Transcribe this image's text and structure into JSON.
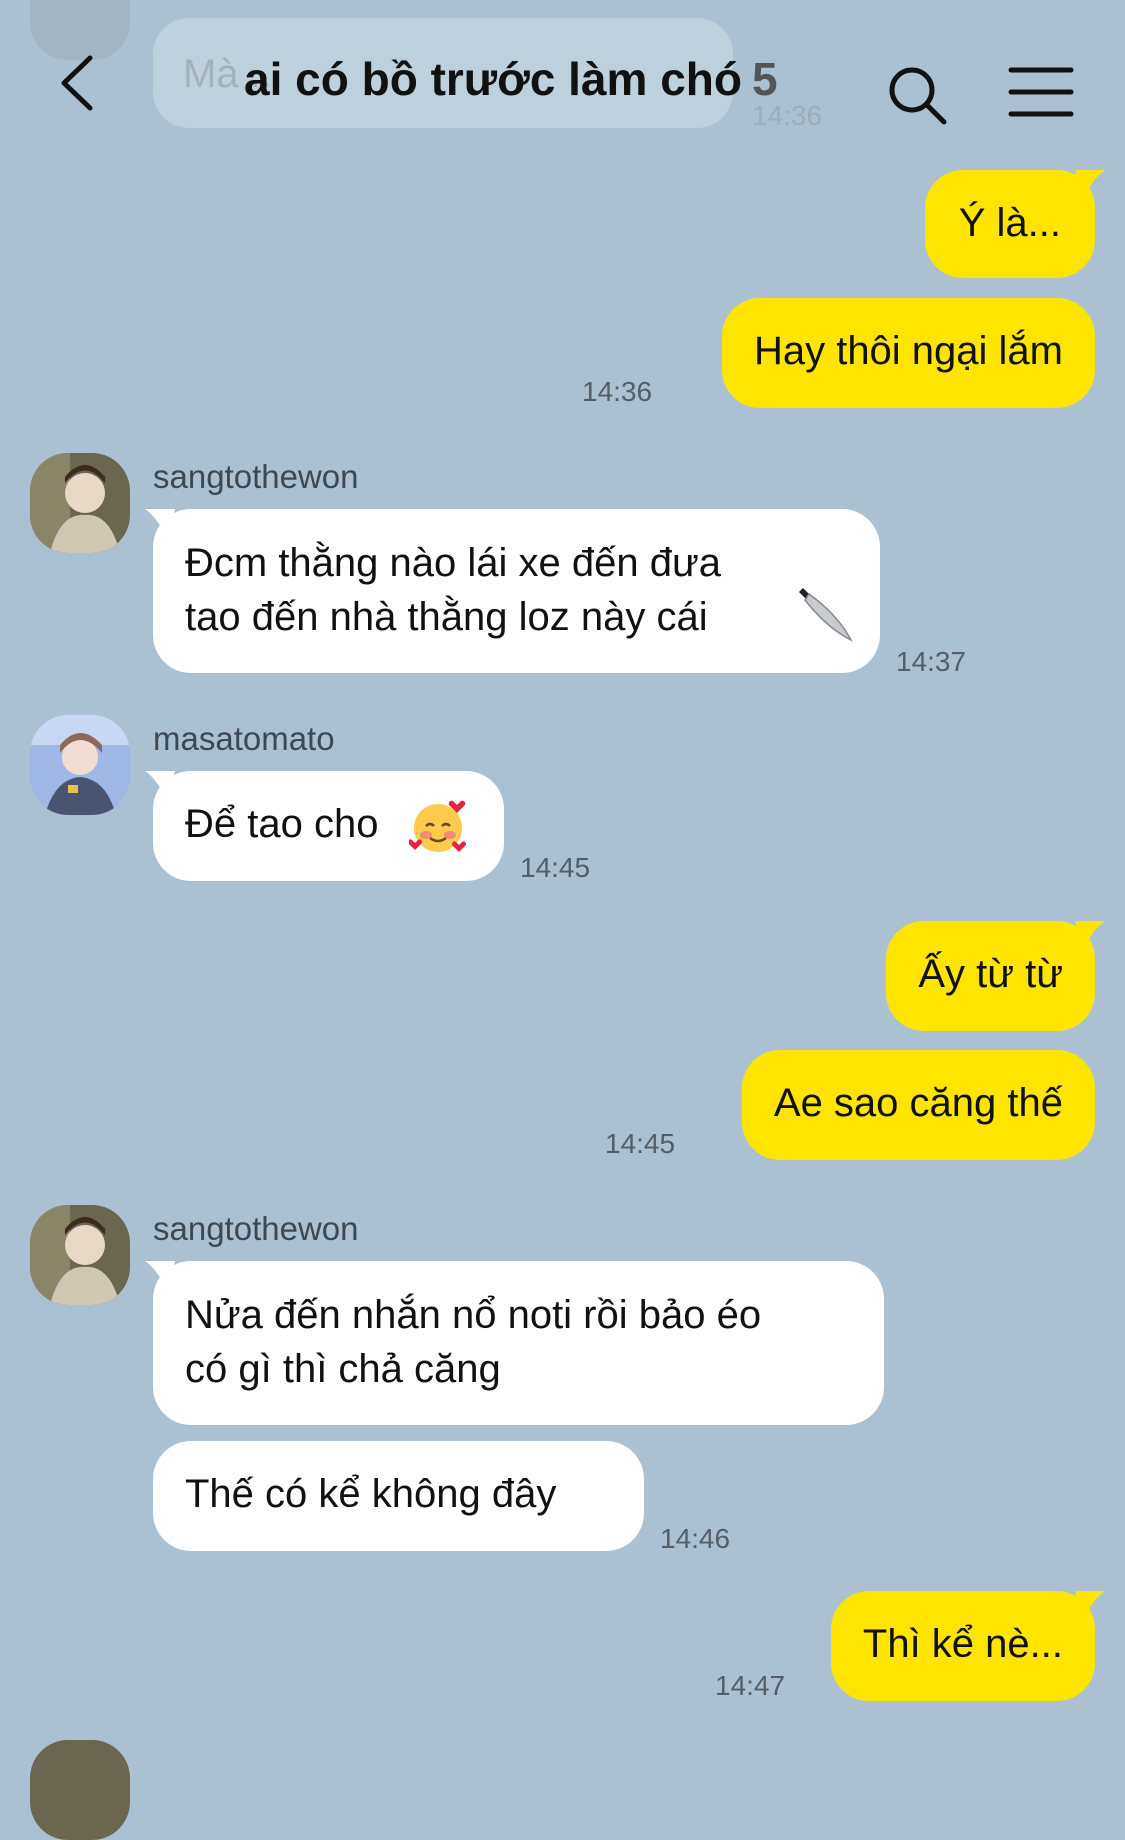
{
  "header": {
    "title": "ai có bồ trước làm chó",
    "member_count": "5",
    "background_preview_text": "Mà ...",
    "background_preview_time": "14:36"
  },
  "messages": [
    {
      "id": "m1",
      "from": "me",
      "text": "Ý là..."
    },
    {
      "id": "m2",
      "from": "me",
      "text": "Hay thôi ngại lắm",
      "time": "14:36"
    },
    {
      "id": "m3",
      "from": "other",
      "sender": "sangtothewon",
      "lines": [
        "Đcm thằng nào lái xe đến đưa",
        "tao đến nhà thằng loz này cái"
      ],
      "time": "14:37"
    },
    {
      "id": "m4",
      "from": "other",
      "sender": "masatomato",
      "text": "Để tao cho",
      "time": "14:45"
    },
    {
      "id": "m5",
      "from": "me",
      "text": "Ấy từ từ"
    },
    {
      "id": "m6",
      "from": "me",
      "text": "Ae sao căng thế",
      "time": "14:45"
    },
    {
      "id": "m7",
      "from": "other",
      "sender": "sangtothewon",
      "lines": [
        "Nửa đến nhắn nổ noti rồi bảo éo",
        "có gì thì chả căng"
      ]
    },
    {
      "id": "m8",
      "from": "other",
      "text": "Thế có kể không đây",
      "time": "14:46"
    },
    {
      "id": "m9",
      "from": "me",
      "text": "Thì kể nè...",
      "time": "14:47"
    }
  ],
  "icons": {
    "back": "chevron-left-icon",
    "search": "search-icon",
    "menu": "hamburger-menu-icon",
    "knife": "knife-emoji",
    "smile": "smiling-face-with-hearts-emoji"
  },
  "colors": {
    "background": "#abc1d1",
    "my_bubble": "#fee500",
    "other_bubble": "#ffffff",
    "timestamp": "#555e66"
  }
}
